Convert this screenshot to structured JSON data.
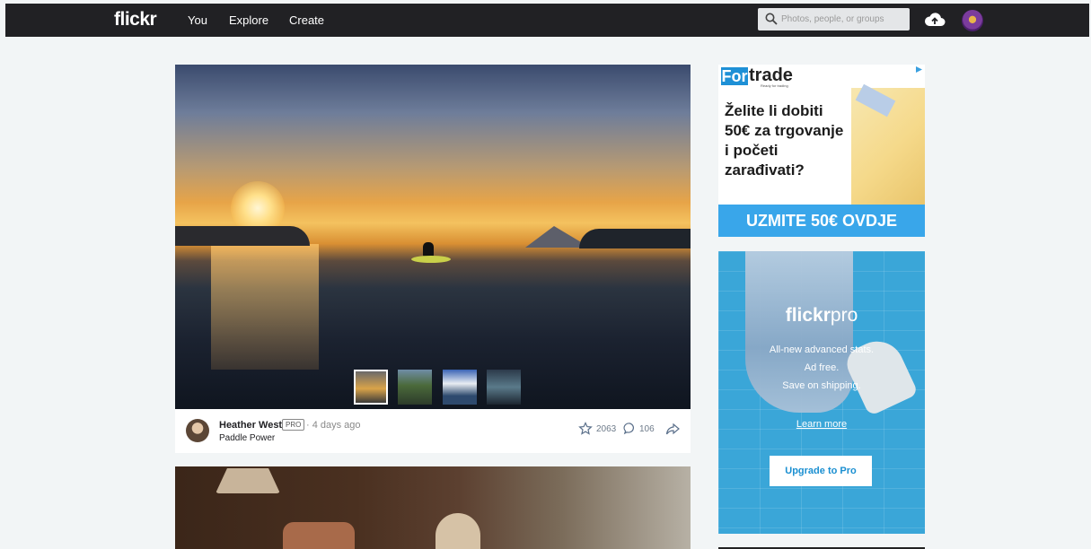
{
  "nav": {
    "logo": "flickr",
    "items": [
      "You",
      "Explore",
      "Create"
    ],
    "search_placeholder": "Photos, people, or groups"
  },
  "post": {
    "author": "Heather West",
    "badge": "PRO",
    "posted": "· 4 days ago",
    "title": "Paddle Power",
    "faves": "2063",
    "comments": "106"
  },
  "ads": {
    "fortrade": {
      "logo_box": "For",
      "logo_rest": "trade",
      "tagline": "Ready for trading",
      "headline": "Želite li dobiti 50€ za trgovanje i početi zarađivati?",
      "cta": "UZMITE 50€ OVDJE"
    },
    "flickrpro": {
      "brand_bold": "flickr",
      "brand_light": "pro",
      "line1": "All-new advanced stats.",
      "line2": "Ad free.",
      "line3": "Save on shipping.",
      "link": "Learn more",
      "button": "Upgrade to Pro"
    }
  },
  "colors": {
    "topbar": "#212124",
    "page_bg": "#f2f5f6",
    "accent_blue": "#39a6ea"
  }
}
